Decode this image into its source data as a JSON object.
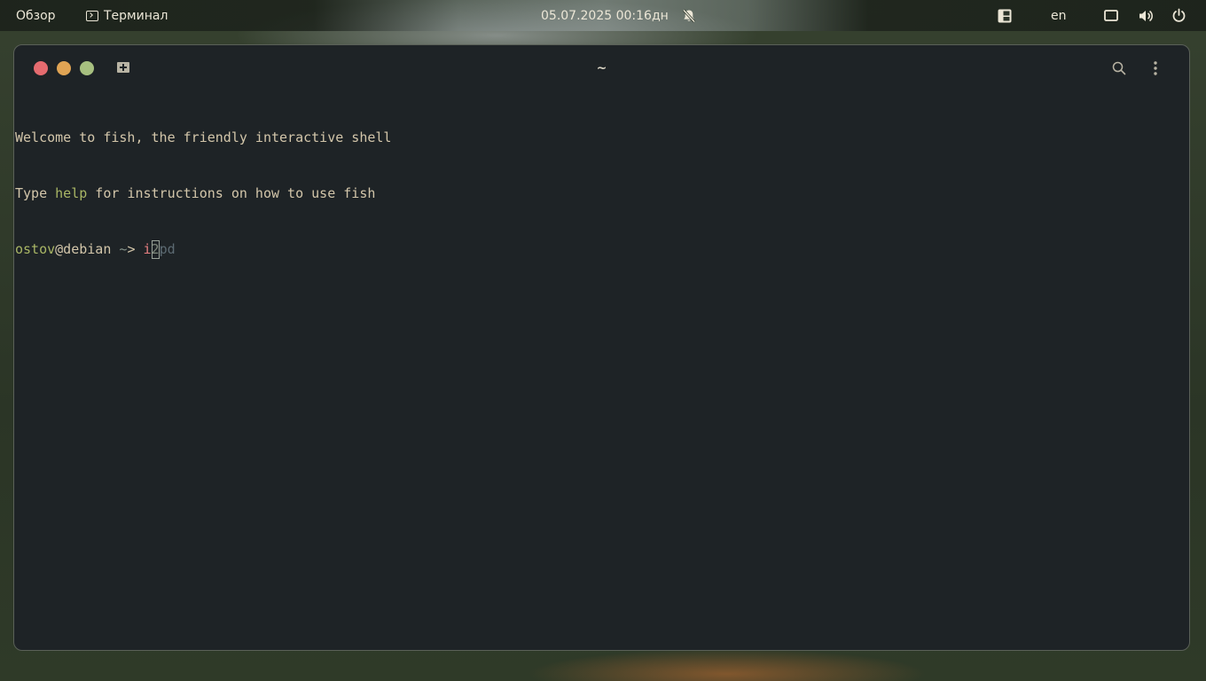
{
  "topbar": {
    "overview_label": "Обзор",
    "app_label": "Терминал",
    "app_icon": "terminal-icon",
    "clock": "05.07.2025 00:16дн",
    "notifications_icon": "bell-muted-icon",
    "layout_icon": "layout-icon",
    "language": "en",
    "screen_icon": "screen-icon",
    "volume_icon": "volume-icon",
    "power_icon": "power-icon"
  },
  "window": {
    "title": "~",
    "new_tab_icon": "new-tab-icon",
    "search_icon": "search-icon",
    "menu_icon": "kebab-menu-icon",
    "colors": {
      "close": "#e56b6f",
      "minimize": "#e0a454",
      "maximize": "#a7c080",
      "background": "#1e2326"
    }
  },
  "terminal": {
    "welcome_line": "Welcome to fish, the friendly interactive shell",
    "help_prefix": "Type ",
    "help_word": "help",
    "help_suffix": " for instructions on how to use fish",
    "prompt_user": "ostov",
    "prompt_host": "@debian",
    "prompt_cwd": " ~",
    "prompt_symbol": "> ",
    "typed_text": "i",
    "cursor_char": "2",
    "autosuggestion": "pd"
  }
}
